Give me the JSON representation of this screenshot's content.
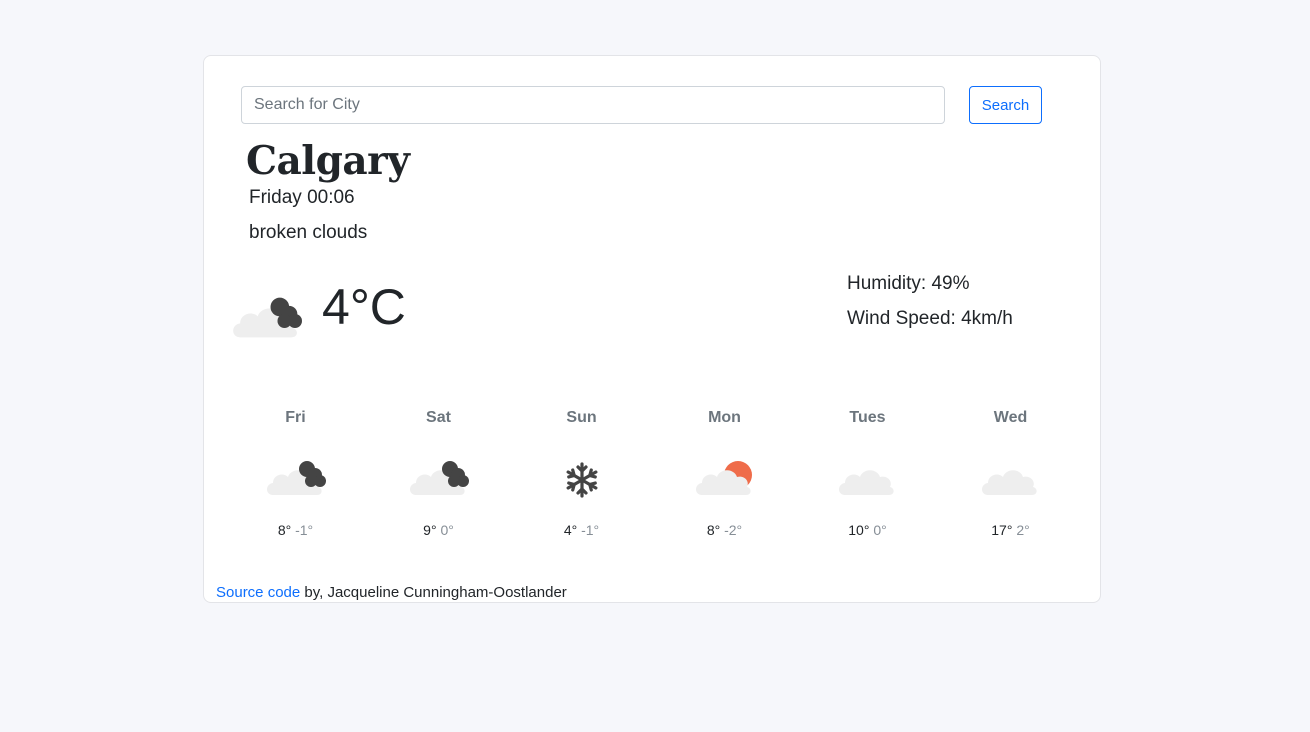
{
  "search": {
    "placeholder": "Search for City",
    "value": "",
    "button_label": "Search"
  },
  "current": {
    "city": "Calgary",
    "date": "Friday 00:06",
    "description": "broken clouds",
    "temperature": "4",
    "unit": "°C",
    "icon": "broken-clouds-icon",
    "humidity_label": "Humidity: 49%",
    "wind_label": "Wind Speed: 4km/h"
  },
  "forecast": [
    {
      "day": "Fri",
      "icon": "broken-clouds-icon",
      "max": "8°",
      "min": "-1°"
    },
    {
      "day": "Sat",
      "icon": "broken-clouds-icon",
      "max": "9°",
      "min": "0°"
    },
    {
      "day": "Sun",
      "icon": "snow-icon",
      "max": "4°",
      "min": "-1°"
    },
    {
      "day": "Mon",
      "icon": "partly-sunny-icon",
      "max": "8°",
      "min": "-2°"
    },
    {
      "day": "Tues",
      "icon": "cloudy-icon",
      "max": "10°",
      "min": "0°"
    },
    {
      "day": "Wed",
      "icon": "cloudy-icon",
      "max": "17°",
      "min": "2°"
    }
  ],
  "footer": {
    "link_label": "Source code",
    "text": " by, Jacqueline Cunningham-Oostlander"
  },
  "colors": {
    "accent": "#0d6efd",
    "sun": "#ef6c4a",
    "dark_cloud": "#444444",
    "light_cloud": "#eeeeee"
  }
}
